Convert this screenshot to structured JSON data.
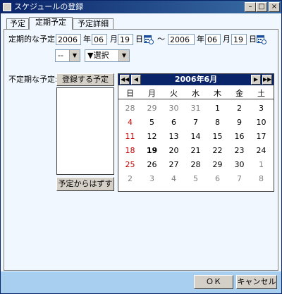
{
  "window": {
    "title": "スケジュールの登録"
  },
  "tabs": [
    {
      "label": "予定"
    },
    {
      "label": "定期予定"
    },
    {
      "label": "予定詳細"
    }
  ],
  "periodic": {
    "label": "定期的な予定:",
    "start": {
      "year": "2006",
      "month": "06",
      "day": "19"
    },
    "end": {
      "year": "2006",
      "month": "06",
      "day": "19"
    },
    "year_unit": "年",
    "month_unit": "月",
    "day_unit": "日",
    "range_sep": "～",
    "interval_select": "--",
    "type_select": "▼選択"
  },
  "irregular": {
    "label": "不定期な予定:",
    "register_button": "登録する予定",
    "remove_button": "予定からはずす"
  },
  "calendar": {
    "month_label": "2006年6月",
    "weekdays": [
      "日",
      "月",
      "火",
      "水",
      "木",
      "金",
      "土"
    ],
    "weeks": [
      [
        "28",
        "29",
        "30",
        "31",
        "1",
        "2",
        "3"
      ],
      [
        "4",
        "5",
        "6",
        "7",
        "8",
        "9",
        "10"
      ],
      [
        "11",
        "12",
        "13",
        "14",
        "15",
        "16",
        "17"
      ],
      [
        "18",
        "19",
        "20",
        "21",
        "22",
        "23",
        "24"
      ],
      [
        "25",
        "26",
        "27",
        "28",
        "29",
        "30",
        "1"
      ],
      [
        "2",
        "3",
        "4",
        "5",
        "6",
        "7",
        "8"
      ]
    ],
    "today": "19",
    "colors": {
      "header": "#0a246a",
      "sunday": "#cc0000",
      "other_month": "#808080"
    }
  },
  "footer": {
    "ok": "ＯＫ",
    "cancel": "キャンセル"
  },
  "colors": {
    "titlebar": "#0a246a",
    "panel": "#f0f7ff",
    "footer": "#a8cff0"
  }
}
